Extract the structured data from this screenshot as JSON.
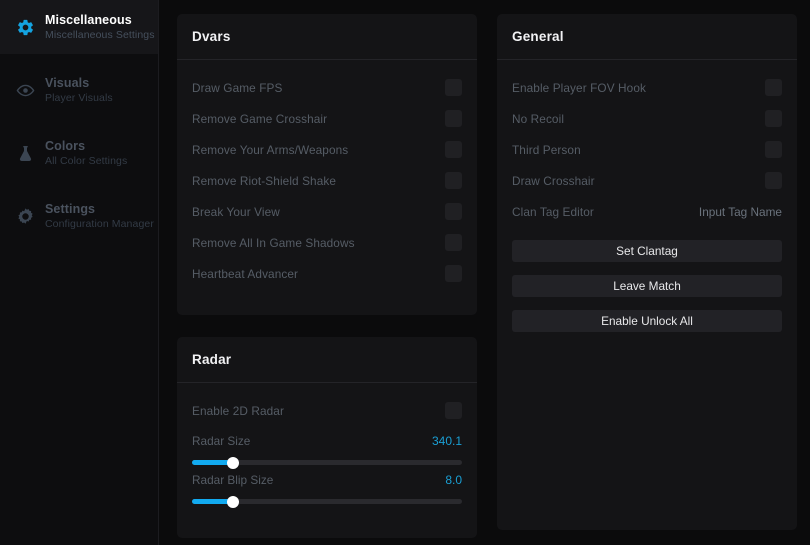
{
  "theme": {
    "accent": "#12aaf0",
    "value_color": "#1a9fd4",
    "panel_bg": "#141416",
    "page_bg": "#0b0b0c",
    "sidebar_bg": "#0d0d0f"
  },
  "sidebar": {
    "items": [
      {
        "icon": "gear-icon",
        "title": "Miscellaneous",
        "subtitle": "Miscellaneous Settings",
        "active": true
      },
      {
        "icon": "eye-icon",
        "title": "Visuals",
        "subtitle": "Player Visuals",
        "active": false
      },
      {
        "icon": "flask-icon",
        "title": "Colors",
        "subtitle": "All Color Settings",
        "active": false
      },
      {
        "icon": "cog-icon",
        "title": "Settings",
        "subtitle": "Configuration Manager",
        "active": false
      }
    ]
  },
  "panels": {
    "dvars": {
      "title": "Dvars",
      "toggles": [
        {
          "label": "Draw Game FPS",
          "checked": false
        },
        {
          "label": "Remove Game Crosshair",
          "checked": false
        },
        {
          "label": "Remove Your Arms/Weapons",
          "checked": false
        },
        {
          "label": "Remove Riot-Shield Shake",
          "checked": false
        },
        {
          "label": "Break Your View",
          "checked": false
        },
        {
          "label": "Remove All In Game Shadows",
          "checked": false
        },
        {
          "label": "Heartbeat Advancer",
          "checked": false
        }
      ]
    },
    "radar": {
      "title": "Radar",
      "toggles": [
        {
          "label": "Enable 2D Radar",
          "checked": false
        }
      ],
      "sliders": [
        {
          "label": "Radar Size",
          "value": "340.1",
          "percent": 15
        },
        {
          "label": "Radar Blip Size",
          "value": "8.0",
          "percent": 15
        }
      ]
    },
    "general": {
      "title": "General",
      "toggles": [
        {
          "label": "Enable Player FOV Hook",
          "checked": false
        },
        {
          "label": "No Recoil",
          "checked": false
        },
        {
          "label": "Third Person",
          "checked": false
        },
        {
          "label": "Draw Crosshair",
          "checked": false
        }
      ],
      "clan_tag": {
        "label": "Clan Tag Editor",
        "placeholder": "Input Tag Name",
        "value": ""
      },
      "buttons": [
        {
          "label": "Set Clantag"
        },
        {
          "label": "Leave Match"
        },
        {
          "label": "Enable Unlock All"
        }
      ]
    }
  }
}
